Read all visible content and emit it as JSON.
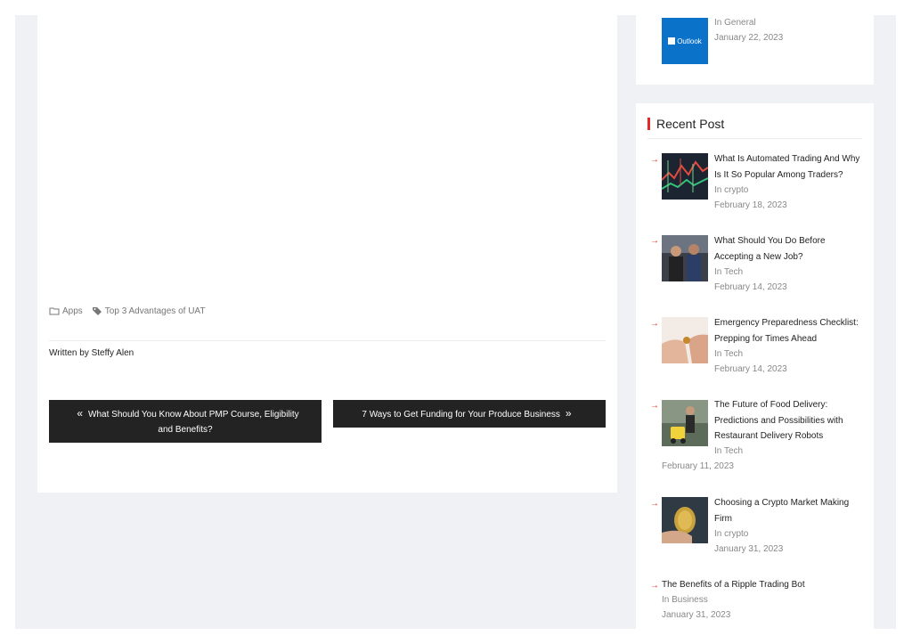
{
  "post_meta": {
    "category": "Apps",
    "tag": "Top 3 Advantages of UAT",
    "author_line": "Written by Steffy Alen"
  },
  "navigation": {
    "prev_label": "What Should You Know About PMP Course, Eligibility and Benefits?",
    "next_label": "7 Ways to Get Funding for Your Produce Business"
  },
  "top_widget_item": {
    "thumb_text": "Outlook",
    "category": "In General",
    "date": "January 22, 2023"
  },
  "recent_posts": {
    "title": "Recent Post",
    "accent": "#e12b2b",
    "items": [
      {
        "title": "What Is Automated Trading And Why Is It So Popular Among Traders?",
        "category": "In crypto",
        "date": "February 18, 2023"
      },
      {
        "title": "What Should You Do Before Accepting a New Job?",
        "category": "In Tech",
        "date": "February 14, 2023"
      },
      {
        "title": "Emergency Preparedness Checklist: Prepping for Times Ahead",
        "category": "In Tech",
        "date": "February 14, 2023"
      },
      {
        "title": "The Future of Food Delivery: Predictions and Possibilities with Restaurant Delivery Robots",
        "category": "In Tech",
        "date": "February 11, 2023"
      },
      {
        "title": "Choosing a Crypto Market Making Firm",
        "category": "In crypto",
        "date": "January 31, 2023"
      },
      {
        "title": "The Benefits of a Ripple Trading Bot",
        "category": "In Business",
        "date": "January 31, 2023"
      }
    ]
  }
}
